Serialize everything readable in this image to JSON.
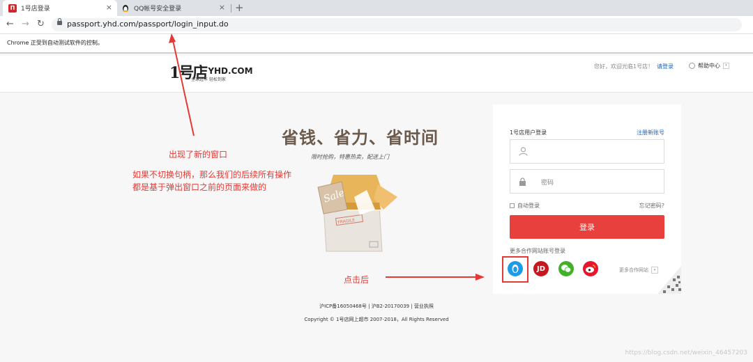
{
  "browser": {
    "tabs": [
      {
        "title": "1号店登录",
        "active": true
      },
      {
        "title": "QQ帐号安全登录",
        "active": false
      }
    ],
    "url": "passport.yhd.com/passport/login_input.do",
    "infobar": "Chrome 正受到自动测试软件的控制。"
  },
  "header": {
    "logo_number": "1号店",
    "logo_text": "YHD.COM",
    "logo_slogan": "全球超市 轻松到家",
    "welcome": "您好，欢迎光临1号店！",
    "login_link": "请登录",
    "help": "帮助中心"
  },
  "promo": {
    "title": "省钱、省力、省时间",
    "subtitle": "限时抢购，特惠热卖，配送上门",
    "box_sale": "Sale",
    "box_fragile": "FRAGILE"
  },
  "login": {
    "title": "1号店用户登录",
    "register": "注册新账号",
    "password_placeholder": "密码",
    "remember": "自动登录",
    "forgot": "忘记密码?",
    "submit": "登录",
    "partner_label": "更多合作网站账号登录",
    "more_partners": "更多合作网站"
  },
  "footer": {
    "line1": "沪ICP备16050468号  |  沪B2-20170039  |  营业执照",
    "line2": "Copyright © 1号店网上超市 2007-2018，All Rights Reserved"
  },
  "annotations": {
    "new_window": "出现了新的窗口",
    "note_line1": "如果不切换句柄，那么我们的后续所有操作",
    "note_line2": "都是基于弹出窗口之前的页面来做的",
    "after_click": "点击后"
  },
  "watermark": "https://blog.csdn.net/weixin_46457203",
  "colors": {
    "accent_red": "#e8413d",
    "annotation_red": "#e53935",
    "link_blue": "#1a62c4"
  }
}
